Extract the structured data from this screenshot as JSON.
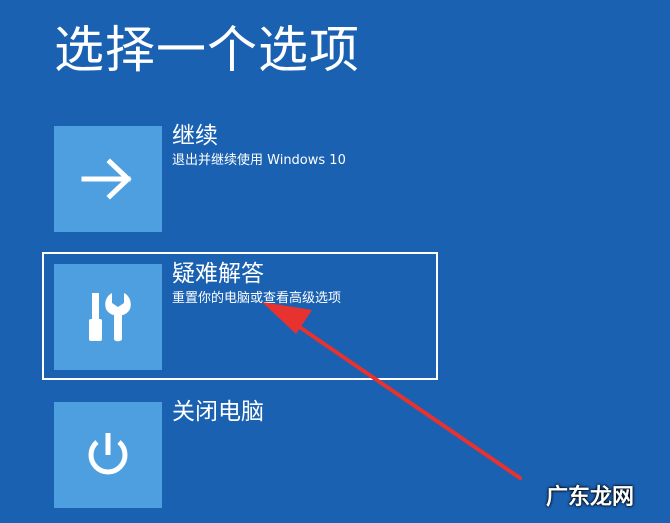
{
  "page": {
    "title": "选择一个选项"
  },
  "options": [
    {
      "label": "继续",
      "description": "退出并继续使用 Windows 10",
      "icon": "arrow-right-icon"
    },
    {
      "label": "疑难解答",
      "description": "重置你的电脑或查看高级选项",
      "icon": "tools-icon",
      "selected": true
    },
    {
      "label": "关闭电脑",
      "description": "",
      "icon": "power-icon"
    }
  ],
  "watermark": {
    "text": "广东龙网"
  },
  "colors": {
    "background": "#1a61b2",
    "tile": "#4e9fe0",
    "annotation_arrow": "#e8322f"
  }
}
